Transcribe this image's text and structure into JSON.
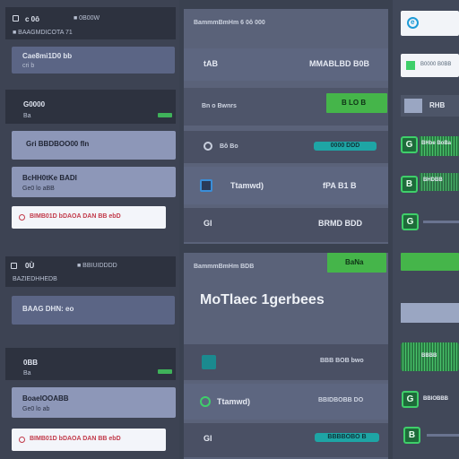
{
  "left": {
    "top": {
      "title": "c 0ô",
      "subtitle": "■ 0B00W",
      "cards": [
        {
          "line1": "■ BAAGMDICOTA 71",
          "line2": ""
        },
        {
          "line1": "Cae8mi1D0 bb",
          "line2": "cri b"
        }
      ],
      "section": {
        "title": "G0000",
        "sub": "Ba"
      },
      "rows": [
        {
          "label": "Gri BBDBOO00 fIn"
        },
        {
          "label": "BcHH0tKe BADI",
          "sub": "Ge0 lo aBB"
        },
        {
          "label": "BIMB01D bDAOA DAN BB ebD"
        }
      ]
    },
    "bottom": {
      "title": "0Ù",
      "subtitle": "■ BBIUIDDDD",
      "cards": [
        {
          "line1": "BAZIEDHHEDB",
          "line2": ""
        },
        {
          "line1": "BAAG DHN: eo",
          "line2": ""
        }
      ],
      "section": {
        "title": "0BB",
        "sub": "Ba"
      },
      "rows": [
        {
          "label": "BoaeIOOABB",
          "sub": "Ge0 lo ab"
        },
        {
          "label": "BIMB01D bDAOA DAN BB ebD"
        }
      ]
    }
  },
  "middle": {
    "top": {
      "header": "BammmBmHm 6 0ô 000",
      "rows": [
        {
          "left": "tAB",
          "right": "MMABLBD B0B"
        },
        {
          "left": "Bn o Bwnrs",
          "button": "B LO B"
        },
        {
          "left": "Bô Bo",
          "badge": "0000 DDD"
        },
        {
          "left": "Ttamwd)",
          "right": "fPA B1 B"
        },
        {
          "left": "Gl",
          "right": "BRMD BDD"
        }
      ]
    },
    "bottom": {
      "header": "BammmBmHm BDB",
      "button": "BaNa",
      "title": "MoTlaec 1gerbees",
      "rows": [
        {
          "left": "",
          "right": "BBB BOB bwo"
        },
        {
          "left": "Ttamwd)",
          "right": "BBIDBOBB DO"
        },
        {
          "left": "Gl",
          "badge": "BBBBOBO B"
        }
      ]
    }
  },
  "right": {
    "top": {
      "cards": [
        {
          "icon": "e"
        },
        {
          "label": "B0000 B0BB"
        }
      ],
      "strip": "RHB",
      "items": [
        {
          "icon": "G",
          "label": "BHbe BoBa"
        },
        {
          "icon": "B",
          "label": "BHDBB"
        },
        {
          "icon": "G",
          "label": ""
        }
      ]
    },
    "bottom": {
      "items": [
        {
          "icon": "B",
          "label": "BBBB"
        },
        {
          "icon": "G",
          "label": "BBIOBBB"
        },
        {
          "icon": "B",
          "label": ""
        }
      ]
    }
  }
}
